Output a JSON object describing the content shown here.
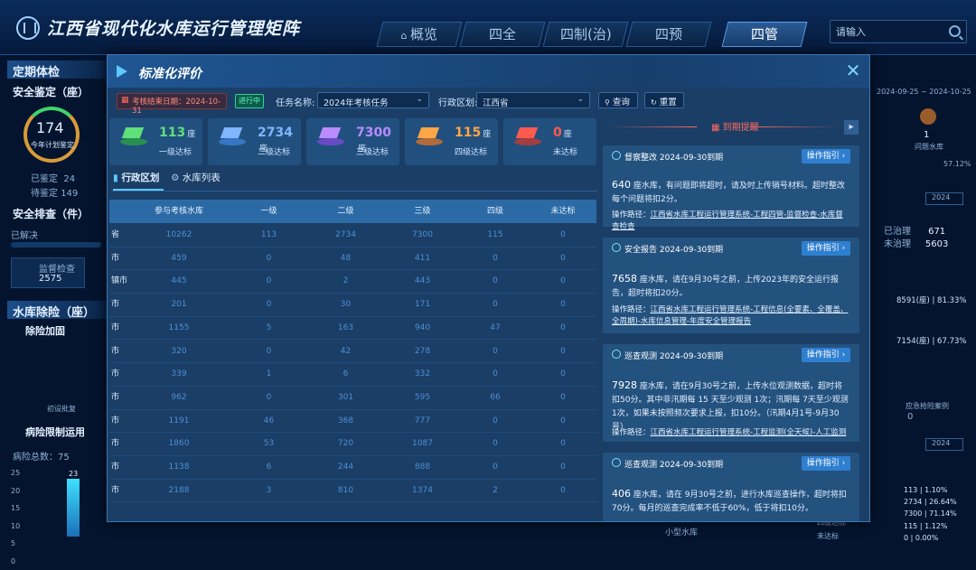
{
  "header": {
    "title": "江西省现代化水库运行管理矩阵",
    "tabs": [
      "概览",
      "四全",
      "四制(治)",
      "四预",
      "四管"
    ],
    "active_tab": "四管",
    "search_placeholder": "请输入"
  },
  "background_panel": {
    "left_sections": {
      "routine_checkup": "定期体检",
      "safety_appraisal": "安全鉴定（座）",
      "gauge_value": "174",
      "gauge_label": "今年计划鉴定",
      "done_label": "已鉴定",
      "done_value": "24",
      "pending_label": "待鉴定",
      "pending_value": "149",
      "safety_check": "安全排查（件）",
      "resolved": "已解决",
      "supervision": "监督检查",
      "supervision_value": "2575",
      "reservoir_risk": "水库除险（座）",
      "reinforce": "除险加固",
      "first_approval": "初设批复",
      "limited_use": "病险限制运用",
      "risk_total_label": "病险总数：",
      "risk_total_value": "75",
      "bar_value": "23",
      "y_ticks": [
        "25",
        "20",
        "15",
        "10",
        "5",
        "0"
      ]
    },
    "right_sections": {
      "date_range": "2024-09-25 ~ 2024-10-25",
      "problem_count": "1",
      "problem_label": "问题水库",
      "pct_1": "57.12%",
      "year_1": "2024",
      "treated_label": "已治理",
      "treated_value": "671",
      "untreated_label": "未治理",
      "untreated_value": "5603",
      "row_a": "8591(座)",
      "row_a_pct": "81.33%",
      "row_b": "7154(座)",
      "row_b_pct": "67.73%",
      "emergency": "应急抢险案例",
      "emergency_value": "0",
      "year_2": "2024",
      "stats": [
        {
          "val": "113",
          "pct": "1.10%"
        },
        {
          "val": "2734",
          "pct": "26.64%"
        },
        {
          "val": "7300",
          "pct": "71.14%"
        },
        {
          "val": "115",
          "pct": "1.12%"
        },
        {
          "val": "0",
          "pct": "0.00%"
        }
      ],
      "level4_label": "四级达标",
      "fail_label": "未达标",
      "small_reservoir": "小型水库"
    }
  },
  "modal": {
    "title": "标准化评价",
    "deadline": "考核结束日期：2024-10-31",
    "status": "进行中",
    "task_label": "任务名称:",
    "task_value": "2024年考核任务",
    "region_label": "行政区划:",
    "region_value": "江西省",
    "query": "查询",
    "reset": "重置",
    "cards": [
      {
        "value": "113",
        "unit": "座",
        "label": "一级达标",
        "color": "#5fe07a"
      },
      {
        "value": "2734",
        "unit": "座",
        "label": "二级达标",
        "color": "#7fb6ff"
      },
      {
        "value": "7300",
        "unit": "座",
        "label": "三级达标",
        "color": "#b98bff"
      },
      {
        "value": "115",
        "unit": "座",
        "label": "四级达标",
        "color": "#ffa647"
      },
      {
        "value": "0",
        "unit": "座",
        "label": "未达标",
        "color": "#ff5a4e"
      }
    ],
    "tabs": [
      "行政区划",
      "水库列表"
    ],
    "table": {
      "headers": [
        "",
        "参与考核水库",
        "一级",
        "二级",
        "三级",
        "四级",
        "未达标"
      ],
      "rows": [
        [
          "省",
          "10262",
          "113",
          "2734",
          "7300",
          "115",
          "0"
        ],
        [
          "市",
          "459",
          "0",
          "48",
          "411",
          "0",
          "0"
        ],
        [
          "镇市",
          "445",
          "0",
          "2",
          "443",
          "0",
          "0"
        ],
        [
          "市",
          "201",
          "0",
          "30",
          "171",
          "0",
          "0"
        ],
        [
          "市",
          "1155",
          "5",
          "163",
          "940",
          "47",
          "0"
        ],
        [
          "市",
          "320",
          "0",
          "42",
          "278",
          "0",
          "0"
        ],
        [
          "市",
          "339",
          "1",
          "6",
          "332",
          "0",
          "0"
        ],
        [
          "市",
          "962",
          "0",
          "301",
          "595",
          "66",
          "0"
        ],
        [
          "市",
          "1191",
          "46",
          "368",
          "777",
          "0",
          "0"
        ],
        [
          "市",
          "1860",
          "53",
          "720",
          "1087",
          "0",
          "0"
        ],
        [
          "市",
          "1138",
          "6",
          "244",
          "888",
          "0",
          "0"
        ],
        [
          "市",
          "2188",
          "3",
          "810",
          "1374",
          "2",
          "0"
        ]
      ]
    },
    "reminder_title": "到期提醒",
    "reminders": [
      {
        "title": "督察整改 2024-09-30到期",
        "btn": "操作指引",
        "count": "640",
        "text": "座水库，有问题即将超时，请及时上传销号材料。超时整改每个问题将扣2分。",
        "path_label": "操作路径：",
        "path": "江西省水库工程运行管理系统-工程四管-监督检查-水库督查检查"
      },
      {
        "title": "安全报告 2024-09-30到期",
        "btn": "操作指引",
        "count": "7658",
        "text": "座水库，请在9月30号之前，上传2023年的安全运行报告，超时将扣20分。",
        "path_label": "操作路径：",
        "path": "江西省水库工程运行管理系统-工程信息(全要素、全覆盖、全周期)-水库信息管理-年度安全管理报告"
      },
      {
        "title": "巡查观测 2024-09-30到期",
        "btn": "操作指引",
        "count": "7928",
        "text": "座水库，请在9月30号之前，上传水位观测数据，超时将扣50分。其中非汛期每 15 天至少观测 1次；汛期每 7天至少观测 1次，如果未按照频次要求上报，扣10分。（汛期4月1号-9月30号）",
        "path_label": "操作路径：",
        "path": "江西省水库工程运行管理系统-工程监测(全天候)-人工监测"
      },
      {
        "title": "巡查观测 2024-09-30到期",
        "btn": "操作指引",
        "count": "406",
        "text": "座水库，请在 9月30号之前，进行水库巡查操作，超时将扣70分。每月的巡查完成率不低于60%，低于将扣10分。",
        "path_label": "",
        "path": ""
      }
    ]
  }
}
